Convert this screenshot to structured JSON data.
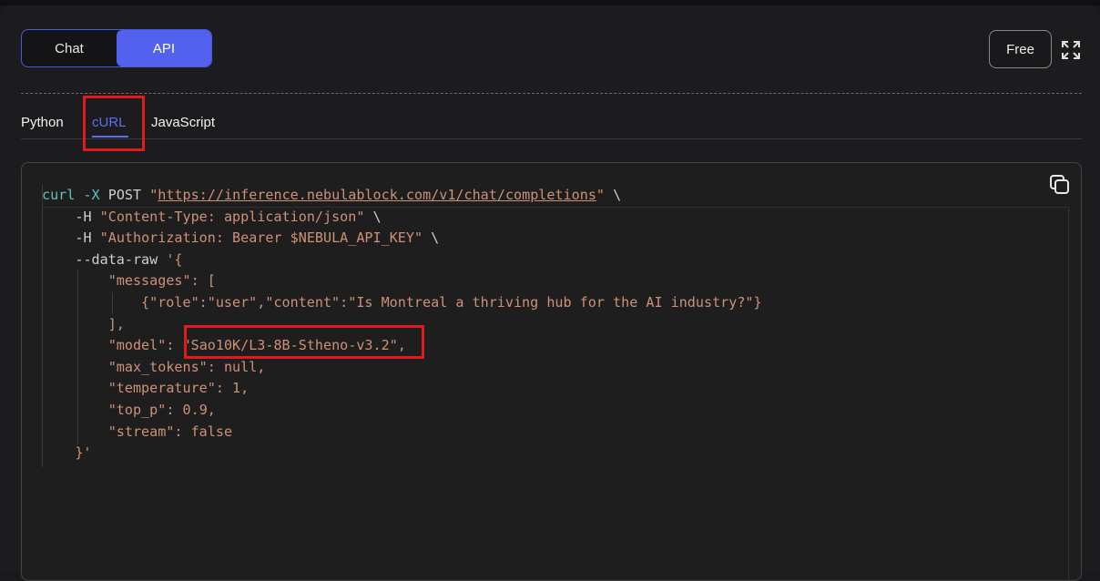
{
  "mode_toggle": {
    "chat_label": "Chat",
    "api_label": "API",
    "selected": "API"
  },
  "header": {
    "plan_label": "Free"
  },
  "icons": {
    "expand": "expand-icon",
    "copy": "copy-icon"
  },
  "language_tabs": [
    {
      "label": "Python",
      "active": false
    },
    {
      "label": "cURL",
      "active": true
    },
    {
      "label": "JavaScript",
      "active": false
    }
  ],
  "code": {
    "cmd": "curl",
    "flag_x": "-X",
    "method": "POST",
    "url": "https://inference.nebulablock.com/v1/chat/completions",
    "header1_flag": "-H",
    "header1": "\"Content-Type: application/json\"",
    "header2_flag": "-H",
    "header2": "\"Authorization: Bearer $NEBULA_API_KEY\"",
    "data_flag": "--data-raw",
    "messages_key": "\"messages\"",
    "message_line": "{\"role\":\"user\",\"content\":\"Is Montreal a thriving hub for the AI industry?\"}",
    "model_key": "\"model\"",
    "model_value": "\"Sao10K/L3-8B-Stheno-v3.2\"",
    "max_tokens_key": "\"max_tokens\"",
    "max_tokens_value": "null",
    "temperature_key": "\"temperature\"",
    "temperature_value": "1",
    "top_p_key": "\"top_p\"",
    "top_p_value": "0.9",
    "stream_key": "\"stream\"",
    "stream_value": "false"
  },
  "colors": {
    "accent": "#5461ee",
    "highlight": "#e01b1b",
    "string": "#ce9178",
    "keyword": "#56c6c0"
  }
}
